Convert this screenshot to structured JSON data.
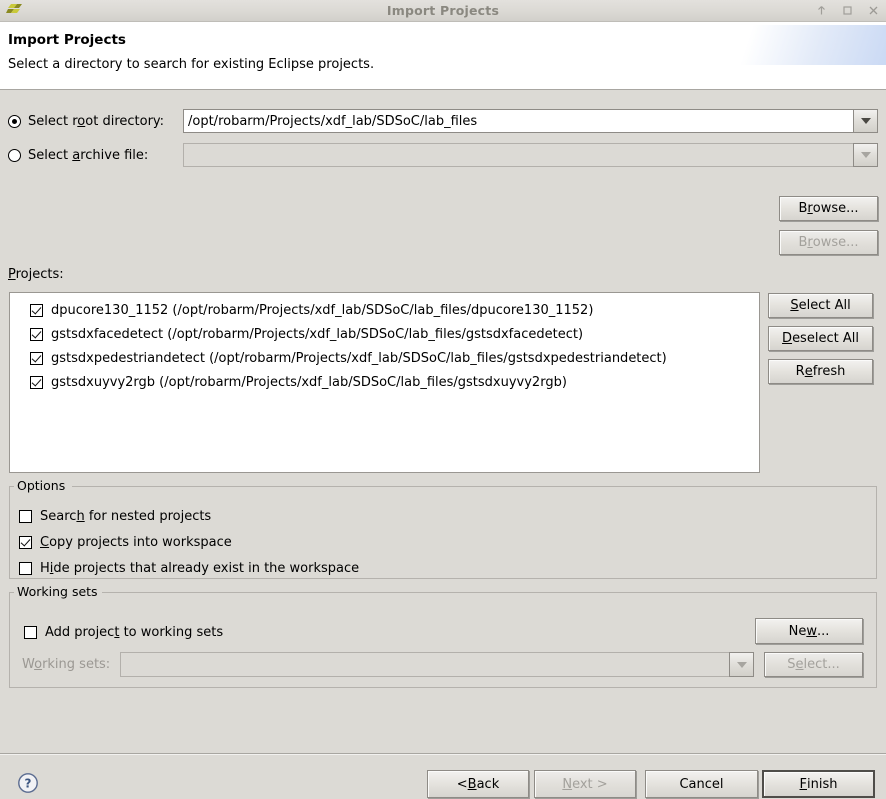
{
  "window": {
    "title": "Import Projects",
    "icon": "eclipse-import-icon",
    "controls": {
      "minimize": "minimize-icon",
      "maximize": "maximize-icon",
      "close": "close-icon"
    }
  },
  "header": {
    "title": "Import Projects",
    "description": "Select a directory to search for existing Eclipse projects."
  },
  "source": {
    "root_directory": {
      "label_pre": "Select r",
      "label_mn": "o",
      "label_post": "ot directory:",
      "selected": true,
      "value": "/opt/robarm/Projects/xdf_lab/SDSoC/lab_files",
      "browse_pre": "B",
      "browse_mn": "r",
      "browse_post": "owse...",
      "browse_enabled": true
    },
    "archive_file": {
      "label_pre": "Select ",
      "label_mn": "a",
      "label_post": "rchive file:",
      "selected": false,
      "value": "",
      "browse_pre": "B",
      "browse_mn": "r",
      "browse_post": "owse...",
      "browse_enabled": false
    }
  },
  "projects": {
    "label_mn": "P",
    "label_post": "rojects:",
    "items": [
      {
        "name": "dpucore130_1152",
        "path": "/opt/robarm/Projects/xdf_lab/SDSoC/lab_files/dpucore130_1152",
        "text": "dpucore130_1152 (/opt/robarm/Projects/xdf_lab/SDSoC/lab_files/dpucore130_1152)",
        "checked": true
      },
      {
        "name": "gstsdxfacedetect",
        "path": "/opt/robarm/Projects/xdf_lab/SDSoC/lab_files/gstsdxfacedetect",
        "text": "gstsdxfacedetect (/opt/robarm/Projects/xdf_lab/SDSoC/lab_files/gstsdxfacedetect)",
        "checked": true
      },
      {
        "name": "gstsdxpedestriandetect",
        "path": "/opt/robarm/Projects/xdf_lab/SDSoC/lab_files/gstsdxpedestriandetect",
        "text": "gstsdxpedestriandetect (/opt/robarm/Projects/xdf_lab/SDSoC/lab_files/gstsdxpedestriandetect)",
        "checked": true
      },
      {
        "name": "gstsdxuyvy2rgb",
        "path": "/opt/robarm/Projects/xdf_lab/SDSoC/lab_files/gstsdxuyvy2rgb",
        "text": "gstsdxuyvy2rgb (/opt/robarm/Projects/xdf_lab/SDSoC/lab_files/gstsdxuyvy2rgb)",
        "checked": true
      }
    ],
    "buttons": {
      "select_all": {
        "pre": "",
        "mn": "S",
        "post": "elect All"
      },
      "deselect_all": {
        "pre": "",
        "mn": "D",
        "post": "eselect All"
      },
      "refresh": {
        "pre": "R",
        "mn": "e",
        "post": "fresh"
      }
    }
  },
  "options": {
    "title": "Options",
    "items": [
      {
        "pre": "Searc",
        "mn": "h",
        "post": " for nested projects",
        "checked": false
      },
      {
        "pre": "",
        "mn": "C",
        "post": "opy projects into workspace",
        "checked": true
      },
      {
        "pre": "H",
        "mn": "i",
        "post": "de projects that already exist in the workspace",
        "checked": false
      }
    ]
  },
  "working_sets": {
    "title": "Working sets",
    "add_checkbox": {
      "pre": "Add projec",
      "mn": "t",
      "post": " to working sets",
      "checked": false
    },
    "combo_label": {
      "pre": "W",
      "mn": "o",
      "post": "rking sets:"
    },
    "combo_value": "",
    "combo_enabled": false,
    "new_button": {
      "pre": "Ne",
      "mn": "w",
      "post": "...",
      "enabled": true
    },
    "select_button": {
      "pre": "S",
      "mn": "e",
      "post": "lect...",
      "enabled": false
    }
  },
  "footer": {
    "help": "help-icon",
    "back": {
      "pre": "< ",
      "mn": "B",
      "post": "ack",
      "enabled": true,
      "default": false
    },
    "next": {
      "pre": "",
      "mn": "N",
      "post": "ext >",
      "enabled": false,
      "default": false
    },
    "cancel": {
      "pre": "Cancel",
      "mn": "",
      "post": "",
      "enabled": true,
      "default": false
    },
    "finish": {
      "pre": "",
      "mn": "F",
      "post": "inish",
      "enabled": true,
      "default": true
    }
  },
  "colors": {
    "dialog_bg": "#dcdad5",
    "header_bg": "#ffffff",
    "field_bg": "#ffffff",
    "border": "#8e8b86",
    "disabled_text": "#a3a19c",
    "title_text": "#8a8880",
    "accent_blue": "#c4d5f3"
  }
}
